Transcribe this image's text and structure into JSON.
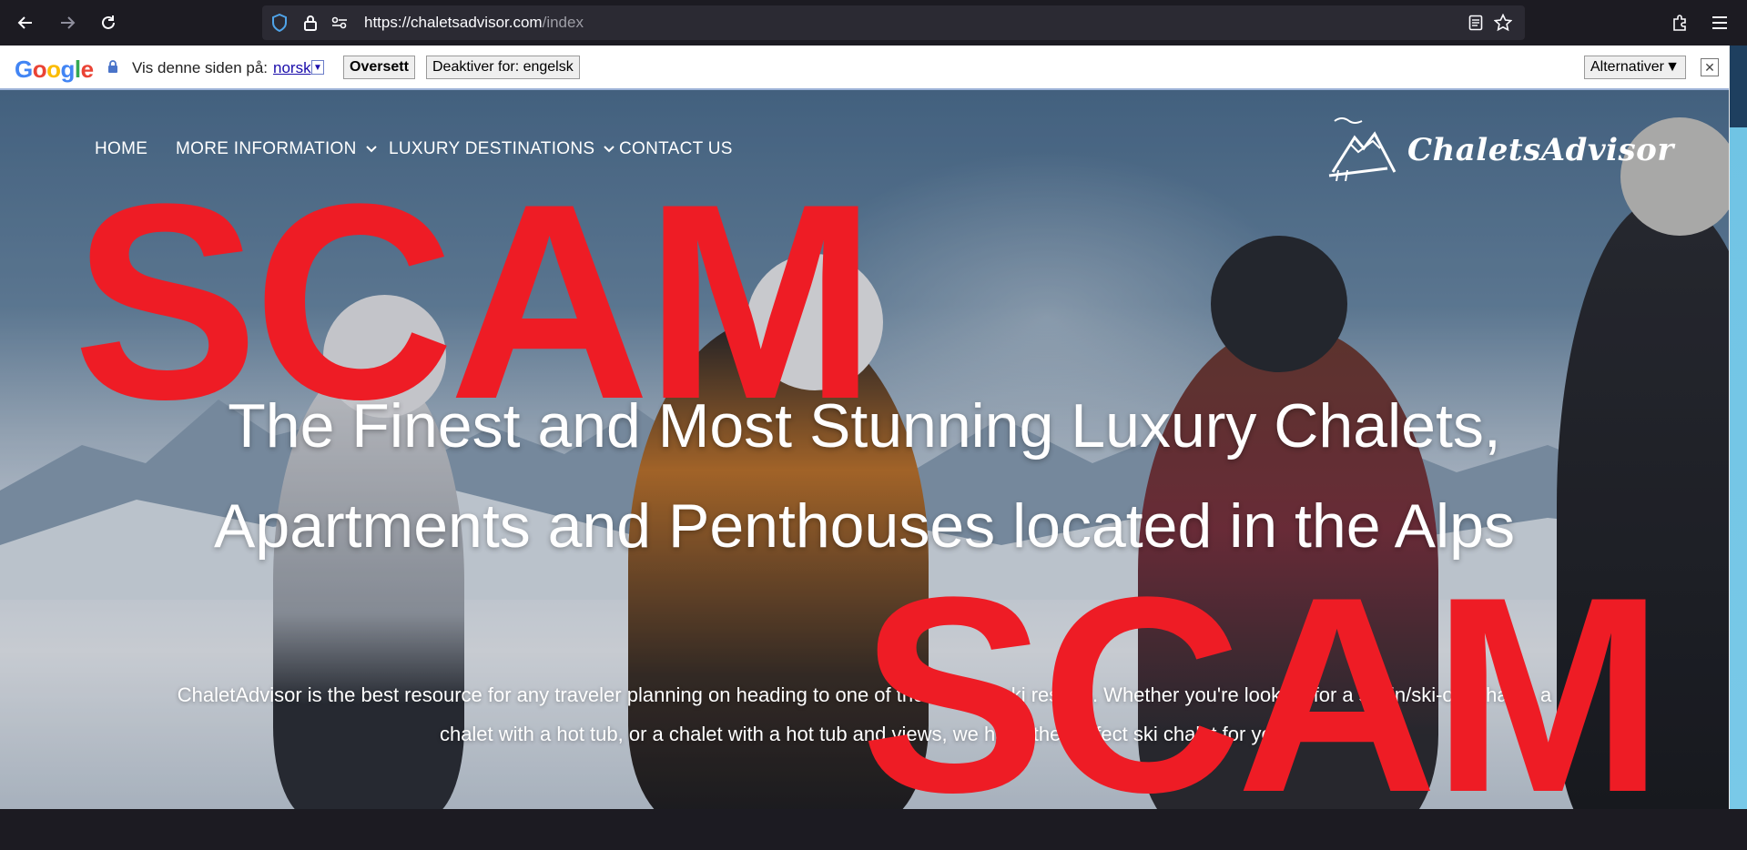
{
  "browser": {
    "url_host": "https://chaletsadvisor.com",
    "url_path": "/index",
    "icons": [
      "back-icon",
      "forward-icon",
      "reload-icon",
      "shield-icon",
      "lock-icon",
      "permissions-icon",
      "reader-view-icon",
      "bookmark-star-icon",
      "extensions-icon",
      "menu-icon"
    ]
  },
  "translate_bar": {
    "logo_letters": [
      "G",
      "o",
      "o",
      "g",
      "l",
      "e"
    ],
    "logo_colors": [
      "#4285f4",
      "#ea4335",
      "#fbbc05",
      "#4285f4",
      "#34a853",
      "#ea4335"
    ],
    "prompt": "Vis denne siden på:",
    "language": "norsk",
    "language_dropdown": "▼",
    "translate_button": "Oversett",
    "disable_button": "Deaktiver for: engelsk",
    "options_button": "Alternativer",
    "options_arrow": "▼",
    "close_symbol": "✕"
  },
  "site": {
    "nav": [
      {
        "label": "HOME",
        "has_dropdown": false
      },
      {
        "label": "MORE INFORMATION",
        "has_dropdown": true
      },
      {
        "label": "LUXURY DESTINATIONS",
        "has_dropdown": true
      },
      {
        "label": "CONTACT US",
        "has_dropdown": false
      }
    ],
    "brand": "ChaletsAdvisor",
    "headline_line1": "The Finest and Most Stunning Luxury Chalets,",
    "headline_line2": "Apartments and Penthouses located in the Alps",
    "sub_line1": "ChaletAdvisor is the best resource for any traveler planning on heading to one of the Alps 25 ski resorts. Whether you're looking for a ski-in/ski-out chalet, a",
    "sub_line2": "chalet with a hot tub, or a chalet with a hot tub and views, we have the perfect ski chalet for you."
  },
  "stamps": {
    "top": "SCAM",
    "bottom": "SCAM",
    "color": "#ee1c25"
  }
}
